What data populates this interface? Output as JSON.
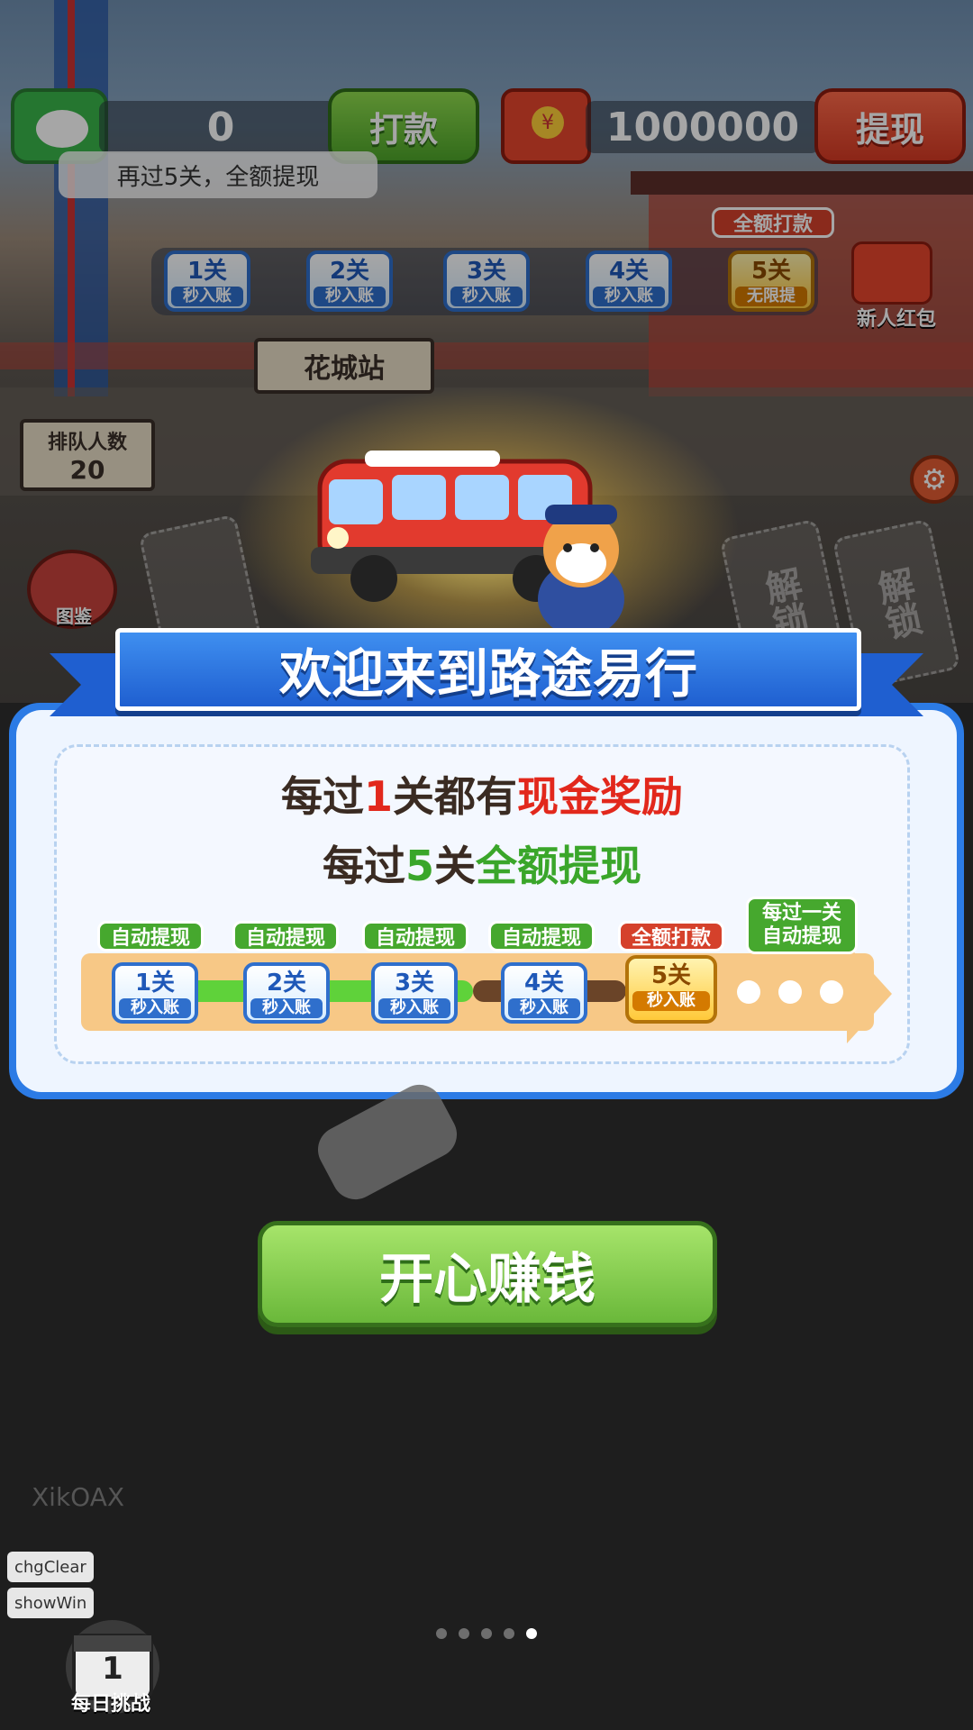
{
  "top_bar": {
    "left_balance": "0",
    "pay_button": "打款",
    "tip": "再过5关，全额提现",
    "right_balance": "1000000",
    "withdraw_button": "提现",
    "redpack_symbol": "¥"
  },
  "level_row": {
    "badge": "全额打款",
    "levels": [
      {
        "title": "1关",
        "sub": "秒入账"
      },
      {
        "title": "2关",
        "sub": "秒入账"
      },
      {
        "title": "3关",
        "sub": "秒入账"
      },
      {
        "title": "4关",
        "sub": "秒入账"
      },
      {
        "title": "5关",
        "sub": "无限提"
      }
    ]
  },
  "side": {
    "new_redpack": "新人红包",
    "album": "图鉴",
    "settings_icon": "gear-icon"
  },
  "scene": {
    "station": "花城站",
    "queue_label": "排队人数",
    "queue_count": "20",
    "locks": [
      "解锁",
      "解锁"
    ]
  },
  "dialog": {
    "title": "欢迎来到路途易行",
    "line1": {
      "pre": "每过",
      "num": "1",
      "mid": "关都有",
      "hl": "现金奖励"
    },
    "line2": {
      "pre": "每过",
      "num": "5",
      "mid": "关",
      "hl": "全额提现"
    },
    "steps": [
      {
        "tag": "自动提现",
        "title": "1关",
        "sub": "秒入账"
      },
      {
        "tag": "自动提现",
        "title": "2关",
        "sub": "秒入账"
      },
      {
        "tag": "自动提现",
        "title": "3关",
        "sub": "秒入账"
      },
      {
        "tag": "自动提现",
        "title": "4关",
        "sub": "秒入账"
      },
      {
        "tag": "全额打款",
        "title": "5关",
        "sub": "秒入账"
      }
    ],
    "last_tag_1": "每过一关",
    "last_tag_2": "自动提现"
  },
  "start_button": "开心赚钱",
  "watermark": "XikOAX",
  "debug": {
    "btn1": "chgClear",
    "btn2": "showWin"
  },
  "daily": {
    "label": "每日挑战",
    "number": "1"
  },
  "pagination": {
    "count": 5,
    "active": 5
  },
  "colors": {
    "accent_blue": "#2c7be5",
    "green": "#5fd23a",
    "red": "#e2281c",
    "gold": "#ffc93a"
  }
}
